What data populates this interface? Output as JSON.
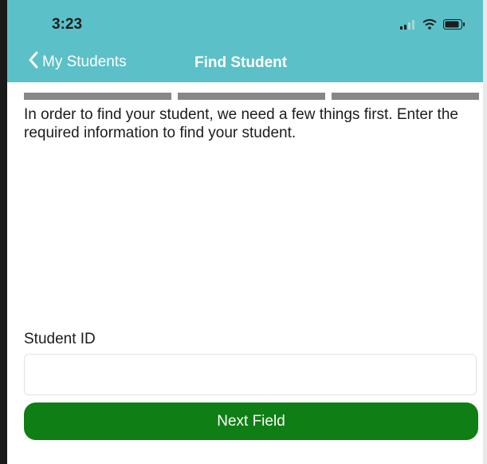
{
  "status_bar": {
    "time": "3:23",
    "icons": [
      "signal-icon",
      "wifi-icon",
      "battery-icon"
    ]
  },
  "nav": {
    "back_label": "My Students",
    "title": "Find Student"
  },
  "progress": {
    "steps_total": 3
  },
  "main": {
    "intro_text": "In order to find your student, we need a few things first. Enter the required information to find your student.",
    "field_label": "Student ID",
    "field_value": "",
    "field_placeholder": "",
    "next_button_label": "Next Field"
  },
  "colors": {
    "header": "#5bc0c8",
    "progress": "#878787",
    "button": "#0f7e14"
  }
}
